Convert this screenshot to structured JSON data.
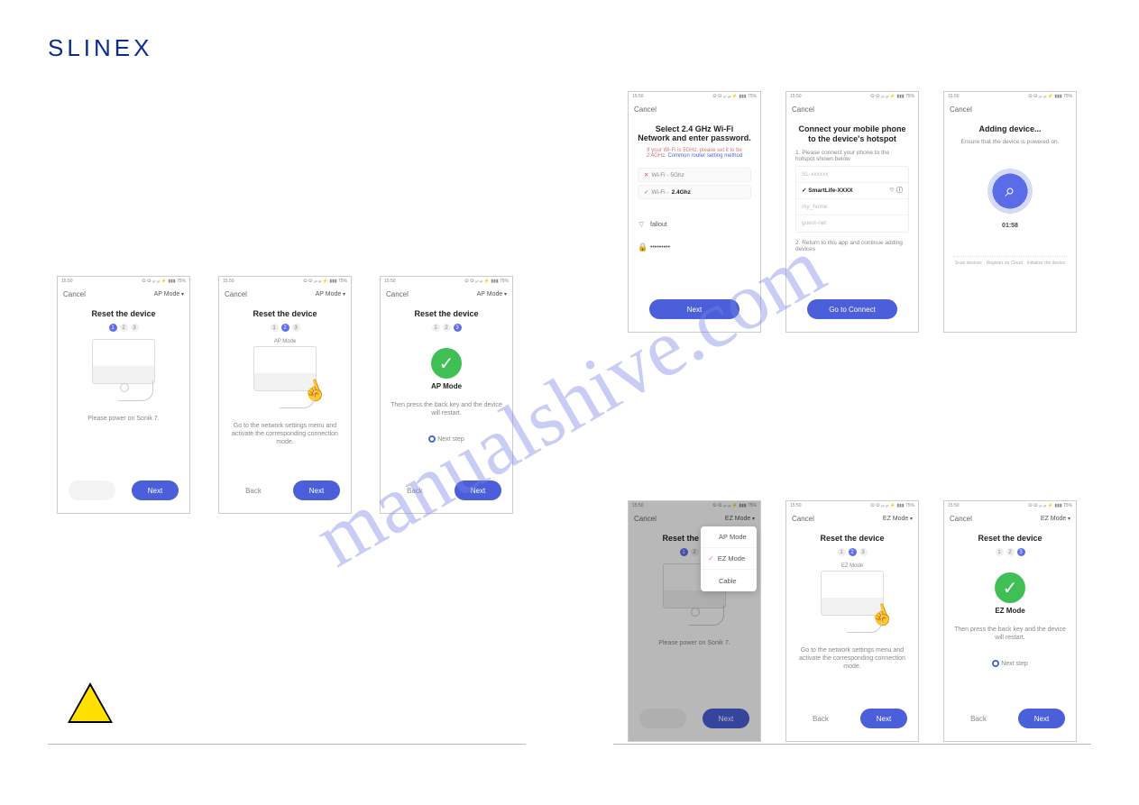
{
  "brand": "SLINEX",
  "watermark": "manualshive.com",
  "labels": {
    "cancel": "Cancel",
    "ap_mode": "AP Mode",
    "ez_mode": "EZ Mode",
    "cable": "Cable",
    "reset": "Reset the device",
    "back": "Back",
    "next": "Next",
    "next_step": "Next step",
    "go_connect": "Go to Connect"
  },
  "ap": {
    "s1": "Please power on Sonik 7.",
    "s2": "Go to the network settings menu and activate the corresponding connection mode.",
    "s3": "Then press the back key and the device will restart.",
    "mode_label": "AP Mode"
  },
  "wifi": {
    "title1": "Select 2.4 GHz Wi-Fi",
    "title2": "Network and enter password.",
    "hint1": "If your Wi-Fi is 5GHz, please set it to be 2.4GHz.",
    "hint_link": "Common router setting method",
    "row5g": "Wi-Fi - 5Ghz",
    "row24g": "Wi-Fi -",
    "row24g_b": "2.4Ghz",
    "ssid": "fallout",
    "pwd": "•••••••••"
  },
  "hotspot": {
    "title": "Connect your mobile phone to the device's hotspot",
    "step1": "1. Please connect your phone to the hotspot shown below",
    "item_sel": "SmartLife-XXXX",
    "item_a": "SL-xxxxxx",
    "item_b": "my_home",
    "item_c": "guest-net",
    "step2": "2. Return to this app and continue adding devices"
  },
  "adding": {
    "title": "Adding device...",
    "sub": "Ensure that the device is powered on.",
    "timer": "01:58",
    "p1": "Scan devices",
    "p2": "Register on Cloud",
    "p3": "Initialize the device"
  },
  "ez": {
    "s1": "Please power on Sonik 7.",
    "s2": "Go to the network settings menu and activate the corresponding connection mode.",
    "s3": "Then press the back key and the device will restart.",
    "mode_label": "EZ Mode"
  },
  "status": {
    "time": "15:50",
    "icons": "ⵙ ⵙ ₐₗₗ ₐₗₗ ⚡ ▮▮▮ 75%"
  }
}
